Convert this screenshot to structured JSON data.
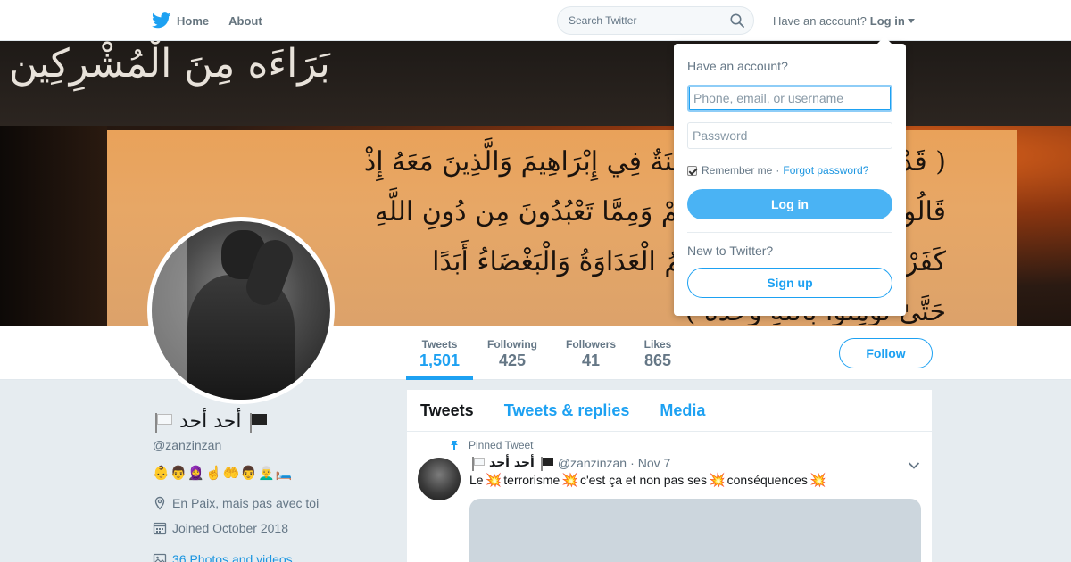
{
  "nav": {
    "home_label": "Home",
    "about_label": "About",
    "search_placeholder": "Search Twitter",
    "have_account": "Have an account?",
    "login_label": "Log in",
    "brand_color": "#1da1f2"
  },
  "banner": {
    "top_text": "بَرَاءَه مِنَ الْمُشْرِكِين",
    "verse_lines": [
      "( قَدْ كَانَتْ لَكُمْ أُسْوَةٌ حَسَنَةٌ فِي إِبْرَاهِيمَ وَالَّذِينَ مَعَهُ إِذْ",
      "قَالُوا لِقَوْمِهِمْ إِنَّا بُرَآءُ مِنكُمْ وَمِمَّا تَعْبُدُونَ مِن دُونِ اللَّهِ",
      "كَفَرْنَا بِكُمْ وَبَدَا بَيْنَنَا وَبَيْنَكُمُ الْعَدَاوَةُ وَالْبَغْضَاءُ أَبَدًا",
      "حَتَّىٰ تُؤْمِنُوا بِاللَّهِ وَحْدَهُ )"
    ]
  },
  "stats": [
    {
      "label": "Tweets",
      "value": "1,501"
    },
    {
      "label": "Following",
      "value": "425"
    },
    {
      "label": "Followers",
      "value": "41"
    },
    {
      "label": "Likes",
      "value": "865"
    }
  ],
  "follow_label": "Follow",
  "profile": {
    "name": "أحد أحد",
    "handle": "@zanzinzan",
    "bio": "👶👨🧕☝️🤲👨👨‍🦳🛏️",
    "location": "En Paix, mais pas avec toi",
    "joined": "Joined October 2018",
    "photos": "36 Photos and videos"
  },
  "timeline": {
    "tabs": [
      "Tweets",
      "Tweets & replies",
      "Media"
    ],
    "pinned_label": "Pinned Tweet",
    "tweet": {
      "name": "أحد أحد",
      "handle": "@zanzinzan",
      "dot": "·",
      "date": "Nov 7",
      "text_parts": [
        "Le ",
        "terrorisme",
        " c'est ça et non pas ses ",
        "conséquences"
      ]
    }
  },
  "login_dropdown": {
    "title": "Have an account?",
    "username_placeholder": "Phone, email, or username",
    "password_placeholder": "Password",
    "remember_label": "Remember me",
    "separator": "·",
    "forgot_label": "Forgot password?",
    "login_button": "Log in",
    "new_label": "New to Twitter?",
    "signup_button": "Sign up"
  }
}
